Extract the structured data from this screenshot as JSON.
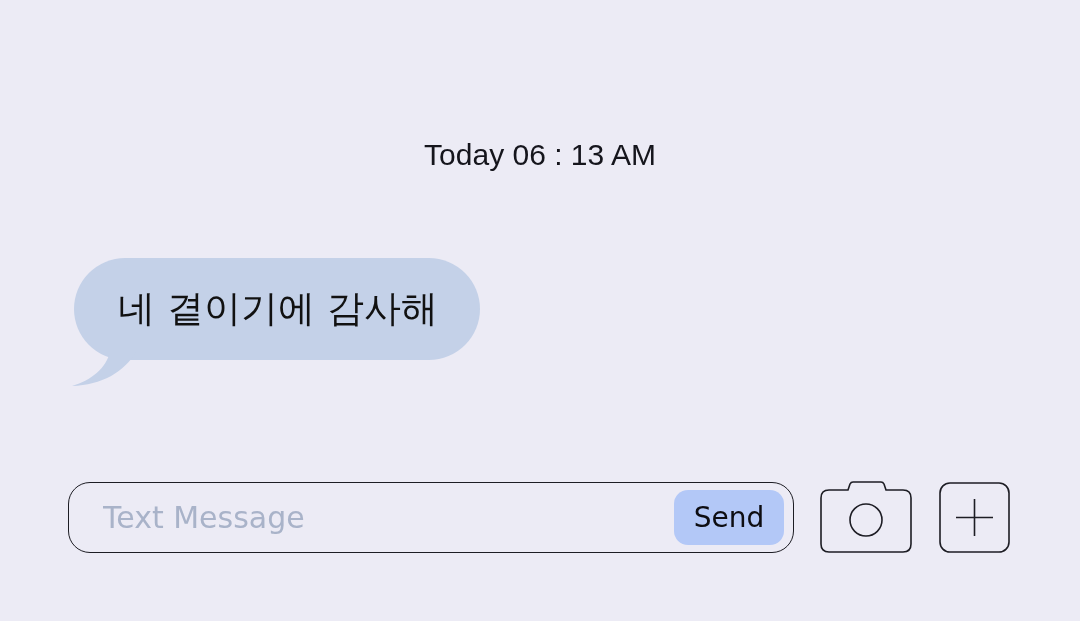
{
  "timestamp": "Today 06 : 13 AM",
  "messages": [
    {
      "kind": "received",
      "text": "네 곁이기에 감사해"
    }
  ],
  "composer": {
    "placeholder": "Text Message",
    "send_button": "Send"
  }
}
